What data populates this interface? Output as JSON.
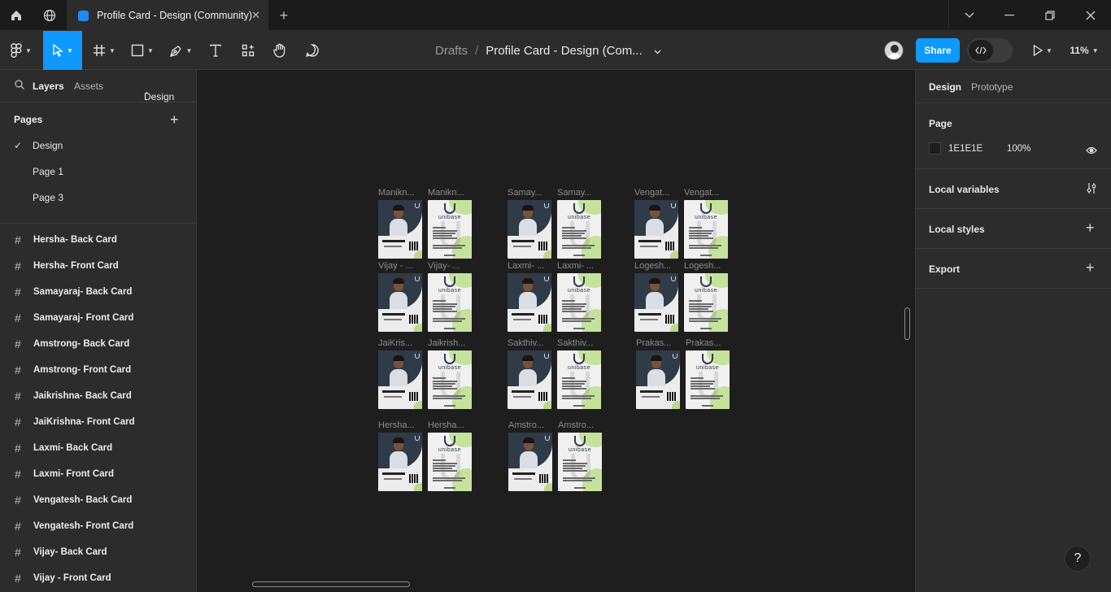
{
  "tabbar": {
    "tab_title": "Profile Card - Design (Community)",
    "close_glyph": "✕",
    "new_tab_glyph": "+",
    "icons": [
      "home-icon",
      "globe-icon",
      "figma-file-icon"
    ],
    "window_controls": [
      "chevron-down-icon",
      "minimize-icon",
      "restore-icon",
      "close-icon"
    ]
  },
  "toolbar": {
    "tools": [
      "figma-menu-icon",
      "move-tool-icon",
      "frame-tool-icon",
      "shape-tool-icon",
      "pen-tool-icon",
      "text-tool-icon",
      "resources-icon",
      "hand-tool-icon",
      "comment-icon"
    ],
    "breadcrumb_parent": "Drafts",
    "breadcrumb_sep": "/",
    "file_name": "Profile Card - Design (Com...",
    "share_label": "Share",
    "zoom": "11%",
    "accent": "#0d99ff"
  },
  "left_panel": {
    "tabs": {
      "layers": "Layers",
      "assets": "Assets",
      "page_selector": "Design"
    },
    "pages_heading": "Pages",
    "pages": [
      {
        "label": "Design",
        "selected": true
      },
      {
        "label": "Page 1",
        "selected": false
      },
      {
        "label": "Page 3",
        "selected": false
      }
    ],
    "layers": [
      "Hersha- Back Card",
      "Hersha- Front Card",
      "Samayaraj- Back Card",
      "Samayaraj- Front Card",
      "Amstrong- Back Card",
      "Amstrong- Front Card",
      "Jaikrishna- Back Card",
      "JaiKrishna- Front Card",
      "Laxmi- Back Card",
      "Laxmi- Front Card",
      "Vengatesh- Back Card",
      "Vengatesh- Front Card",
      "Vijay- Back Card",
      "Vijay - Front Card"
    ]
  },
  "canvas": {
    "background": "#1e1e1e",
    "brand_text": "unibase",
    "frame_labels": [
      "Manikn...",
      "Manikn...",
      "Samay...",
      "Samay...",
      "Vengat...",
      "Vengat...",
      "Vijay - ...",
      "Vijay- ...",
      "Laxmi- ...",
      "Laxmi- ...",
      "Logesh...",
      "Logesh...",
      "JaiKris...",
      "Jaikrish...",
      "Sakthiv...",
      "Sakthiv...",
      "Prakas...",
      "Prakas...",
      "Hersha...",
      "Hersha...",
      "Amstro...",
      "Amstro..."
    ]
  },
  "right_panel": {
    "tabs": {
      "design": "Design",
      "prototype": "Prototype"
    },
    "page_heading": "Page",
    "page_color": "1E1E1E",
    "page_opacity": "100%",
    "local_variables": "Local variables",
    "local_styles": "Local styles",
    "export": "Export"
  },
  "help_label": "?"
}
